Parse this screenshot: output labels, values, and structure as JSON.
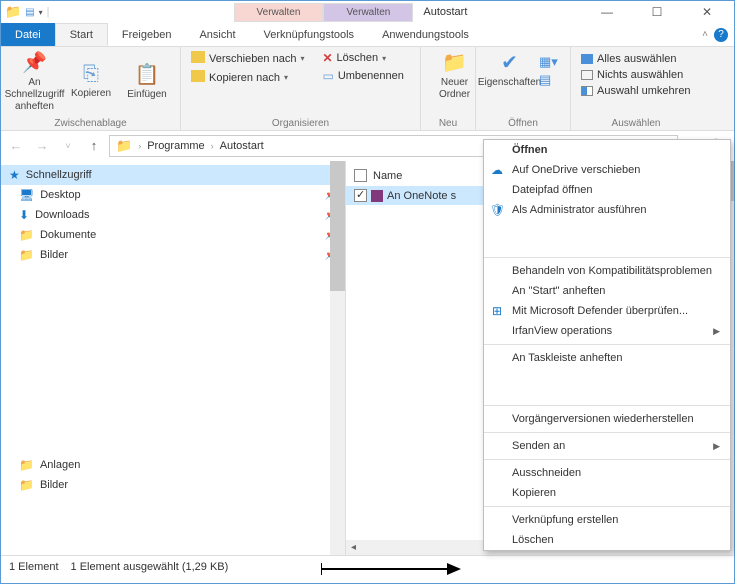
{
  "window": {
    "title": "Autostart"
  },
  "manage": {
    "left": "Verwalten",
    "right": "Verwalten"
  },
  "tabs": {
    "file": "Datei",
    "start": "Start",
    "share": "Freigeben",
    "view": "Ansicht",
    "linktools": "Verknüpfungstools",
    "apptools": "Anwendungstools"
  },
  "ribbon": {
    "clipboard": {
      "pin": "An Schnellzugriff anheften",
      "copy": "Kopieren",
      "paste": "Einfügen",
      "label": "Zwischenablage"
    },
    "organize": {
      "moveTo": "Verschieben nach",
      "copyTo": "Kopieren nach",
      "delete": "Löschen",
      "rename": "Umbenennen",
      "label": "Organisieren"
    },
    "new": {
      "newFolder": "Neuer Ordner",
      "label": "Neu"
    },
    "open": {
      "properties": "Eigenschaften",
      "label": "Öffnen"
    },
    "select": {
      "all": "Alles auswählen",
      "none": "Nichts auswählen",
      "invert": "Auswahl umkehren",
      "label": "Auswählen"
    }
  },
  "path": {
    "seg1": "Programme",
    "seg2": "Autostart"
  },
  "sidebar": {
    "quick": "Schnellzugriff",
    "items": [
      {
        "label": "Desktop"
      },
      {
        "label": "Downloads"
      },
      {
        "label": "Dokumente"
      },
      {
        "label": "Bilder"
      }
    ],
    "bottom": [
      {
        "label": "Anlagen"
      },
      {
        "label": "Bilder"
      }
    ]
  },
  "list": {
    "col_name": "Name",
    "item1": "An OneNote s"
  },
  "status": {
    "count": "1 Element",
    "selected": "1 Element ausgewählt (1,29 KB)"
  },
  "ctx": {
    "open": "Öffnen",
    "onedrive": "Auf OneDrive verschieben",
    "openpath": "Dateipfad öffnen",
    "admin": "Als Administrator ausführen",
    "compat": "Behandeln von Kompatibilitätsproblemen",
    "pinstart": "An \"Start\" anheften",
    "defender": "Mit Microsoft Defender überprüfen...",
    "irfan": "IrfanView operations",
    "pintask": "An Taskleiste anheften",
    "prevver": "Vorgängerversionen wiederherstellen",
    "sendto": "Senden an",
    "cut": "Ausschneiden",
    "copy": "Kopieren",
    "shortcut": "Verknüpfung erstellen",
    "delete": "Löschen"
  }
}
